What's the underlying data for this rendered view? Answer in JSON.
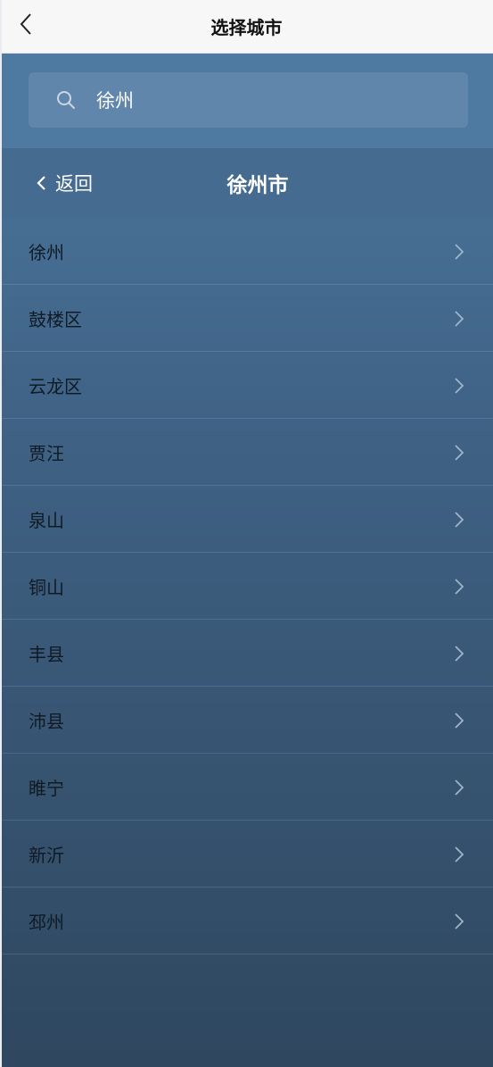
{
  "nav": {
    "title": "选择城市"
  },
  "search": {
    "value": "徐州"
  },
  "sub_header": {
    "back_label": "返回",
    "title": "徐州市"
  },
  "list": {
    "items": [
      {
        "label": "徐州"
      },
      {
        "label": "鼓楼区"
      },
      {
        "label": "云龙区"
      },
      {
        "label": "贾汪"
      },
      {
        "label": "泉山"
      },
      {
        "label": "铜山"
      },
      {
        "label": "丰县"
      },
      {
        "label": "沛县"
      },
      {
        "label": "睢宁"
      },
      {
        "label": "新沂"
      },
      {
        "label": "邳州"
      }
    ]
  },
  "colors": {
    "nav_bg": "#f7f7f7",
    "search_area_bg": "#4e7aa2",
    "search_box_bg": "#6186ab",
    "sub_header_bg": "#456b90",
    "item_text": "#101a24"
  },
  "icons": {
    "nav_back": "chevron-left-icon",
    "search": "search-icon",
    "sub_back": "chevron-left-icon",
    "row": "chevron-right-icon"
  }
}
